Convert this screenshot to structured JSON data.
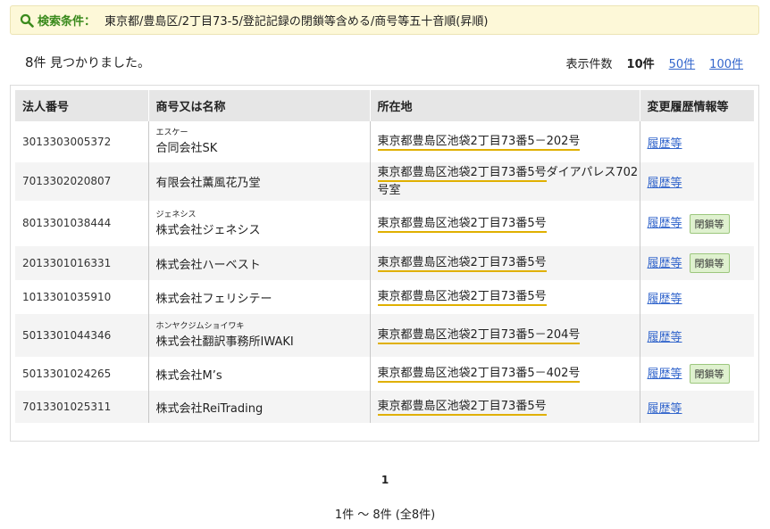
{
  "search": {
    "label": "検索条件：",
    "conditions": "東京都/豊島区/2丁目73-5/登記記録の閉鎖等含める/商号等五十音順(昇順)"
  },
  "results": {
    "count": "8",
    "count_suffix": "件 見つかりました。"
  },
  "per_page": {
    "label": "表示件数",
    "current": "10件",
    "option_50": "50件",
    "option_100": "100件"
  },
  "table": {
    "headers": [
      "法人番号",
      "商号又は名称",
      "所在地",
      "変更履歴情報等"
    ],
    "rows": [
      {
        "number": "3013303005372",
        "kana": "エスケー",
        "name": "合同会社SK",
        "addr_main": "東京都豊島区池袋2丁目73番5－202号",
        "addr_rest": "",
        "history": "履歴等",
        "closed": ""
      },
      {
        "number": "7013302020807",
        "kana": "",
        "name": "有限会社薫風花乃堂",
        "addr_main": "東京都豊島区池袋2丁目73番5号",
        "addr_rest": "ダイアパレス702号室",
        "history": "履歴等",
        "closed": ""
      },
      {
        "number": "8013301038444",
        "kana": "ジェネシス",
        "name": "株式会社ジェネシス",
        "addr_main": "東京都豊島区池袋2丁目73番5号",
        "addr_rest": "",
        "history": "履歴等",
        "closed": "閉鎖等"
      },
      {
        "number": "2013301016331",
        "kana": "",
        "name": "株式会社ハーベスト",
        "addr_main": "東京都豊島区池袋2丁目73番5号",
        "addr_rest": "",
        "history": "履歴等",
        "closed": "閉鎖等"
      },
      {
        "number": "1013301035910",
        "kana": "",
        "name": "株式会社フェリシテー",
        "addr_main": "東京都豊島区池袋2丁目73番5号",
        "addr_rest": "",
        "history": "履歴等",
        "closed": ""
      },
      {
        "number": "5013301044346",
        "kana": "ホンヤクジムショイワキ",
        "name": "株式会社翻訳事務所IWAKI",
        "addr_main": "東京都豊島区池袋2丁目73番5－204号",
        "addr_rest": "",
        "history": "履歴等",
        "closed": ""
      },
      {
        "number": "5013301024265",
        "kana": "",
        "name": "株式会社M’s",
        "addr_main": "東京都豊島区池袋2丁目73番5－402号",
        "addr_rest": "",
        "history": "履歴等",
        "closed": "閉鎖等"
      },
      {
        "number": "7013301025311",
        "kana": "",
        "name": "株式会社ReiTrading",
        "addr_main": "東京都豊島区池袋2丁目73番5号",
        "addr_rest": "",
        "history": "履歴等",
        "closed": ""
      }
    ]
  },
  "pagination": {
    "current_page": "1",
    "range_text": "1件 ～ 8件 (全8件)"
  },
  "colors": {
    "accent_green": "#3a8a1c",
    "link_blue": "#3366cc",
    "address_underline": "#e0b000"
  }
}
